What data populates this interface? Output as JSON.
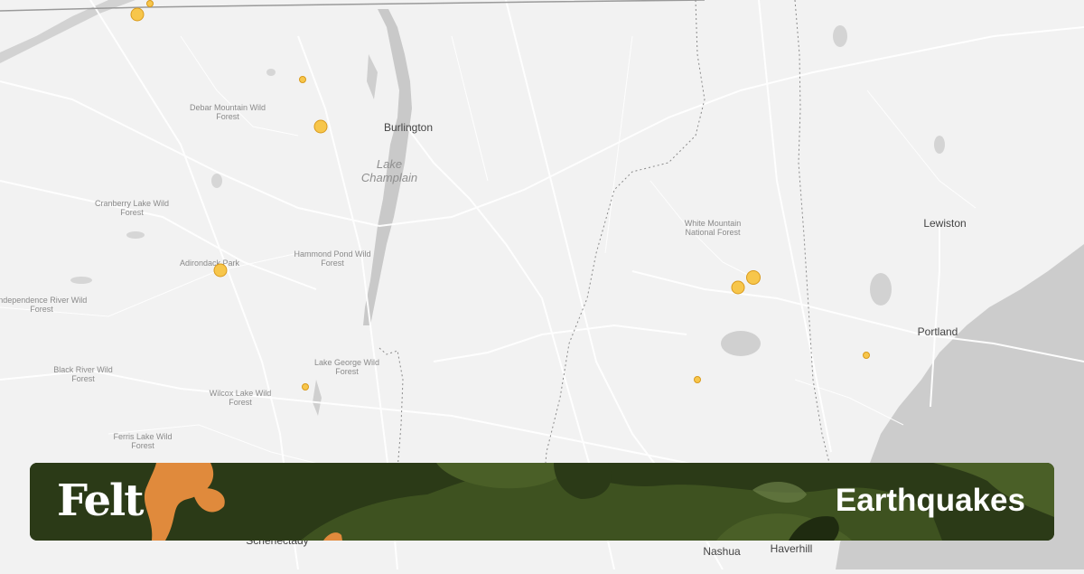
{
  "banner": {
    "brand": "Felt",
    "title": "Earthquakes"
  },
  "cities": [
    {
      "name": "Burlington"
    },
    {
      "name": "Lewiston"
    },
    {
      "name": "Portland"
    },
    {
      "name": "Nashua"
    },
    {
      "name": "Haverhill"
    },
    {
      "name": "Schenectady"
    }
  ],
  "lakes": [
    {
      "name": "Lake Champlain"
    }
  ],
  "regions": [
    {
      "name": "Debar Mountain Wild Forest"
    },
    {
      "name": "Cranberry Lake Wild Forest"
    },
    {
      "name": "Adirondack Park"
    },
    {
      "name": "Independence River Wild Forest"
    },
    {
      "name": "Hammond Pond Wild Forest"
    },
    {
      "name": "Black River Wild Forest"
    },
    {
      "name": "Wilcox Lake Wild Forest"
    },
    {
      "name": "Lake George Wild Forest"
    },
    {
      "name": "Ferris Lake Wild Forest"
    },
    {
      "name": "White Mountain National Forest"
    }
  ],
  "earthquakes": {
    "color": "#f7c64b",
    "border_color": "#d99a1c",
    "points": [
      {
        "id": "q1",
        "magnitude_class": "large"
      },
      {
        "id": "q2",
        "magnitude_class": "small"
      },
      {
        "id": "q3",
        "magnitude_class": "small"
      },
      {
        "id": "q4",
        "magnitude_class": "large"
      },
      {
        "id": "q5",
        "magnitude_class": "large"
      },
      {
        "id": "q6",
        "magnitude_class": "small"
      },
      {
        "id": "q7",
        "magnitude_class": "large"
      },
      {
        "id": "q8",
        "magnitude_class": "large"
      },
      {
        "id": "q9",
        "magnitude_class": "small"
      },
      {
        "id": "q10",
        "magnitude_class": "small"
      }
    ]
  },
  "colors": {
    "land": "#f2f2f2",
    "water": "#c9c9c9",
    "roads": "#ffffff",
    "banner_bg": "#2b3a17",
    "camo_green": "#3e5220",
    "camo_orange": "#e08a3c"
  }
}
